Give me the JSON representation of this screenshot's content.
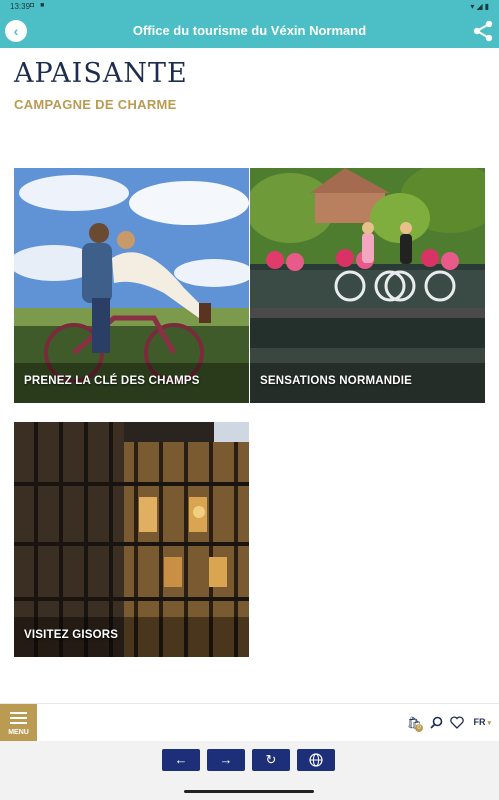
{
  "status_bar": {
    "time": "13:39",
    "left_icons": "◘ ■",
    "right_icons": "▾◢▮"
  },
  "header": {
    "title": "Office du tourisme du Véxin Normand",
    "back_icon": "back-arrow-icon",
    "share_icon": "share-icon"
  },
  "page": {
    "title": "APAISANTE",
    "subtitle": "CAMPAGNE DE CHARME"
  },
  "tiles": [
    {
      "label": "PRENEZ LA CLÉ DES CHAMPS"
    },
    {
      "label": "SENSATIONS NORMANDIE"
    },
    {
      "label": "VISITEZ GISORS"
    }
  ],
  "bottom_bar": {
    "menu_label": "MENU",
    "cart_count": "0",
    "lang": "FR"
  },
  "nav": {
    "back": "←",
    "forward": "→",
    "reload": "↻",
    "web": "🌐"
  },
  "colors": {
    "teal": "#4cbfc6",
    "gold": "#bb9a52",
    "navy": "#1d2f78"
  }
}
